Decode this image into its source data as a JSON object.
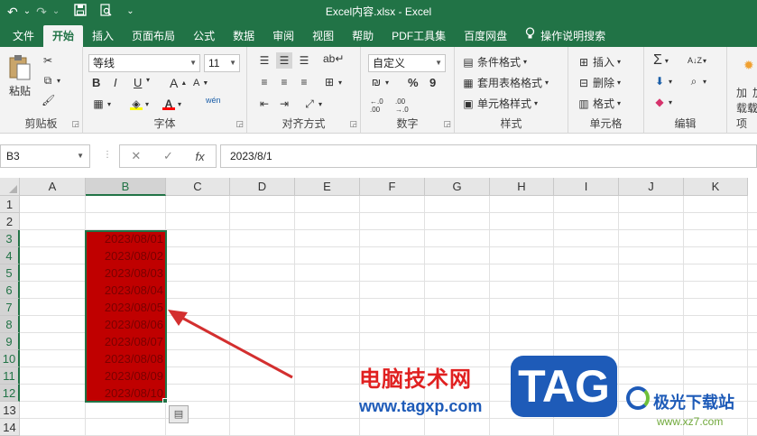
{
  "window": {
    "title": "Excel内容.xlsx  -  Excel"
  },
  "qat": {
    "undo": "↶",
    "undo_dd": "⌄",
    "redo": "↷",
    "redo_dd": "⌄",
    "save": "💾",
    "preview": "🔍",
    "customize": "⌄"
  },
  "tabs": [
    {
      "label": "文件"
    },
    {
      "label": "开始"
    },
    {
      "label": "插入"
    },
    {
      "label": "页面布局"
    },
    {
      "label": "公式"
    },
    {
      "label": "数据"
    },
    {
      "label": "审阅"
    },
    {
      "label": "视图"
    },
    {
      "label": "帮助"
    },
    {
      "label": "PDF工具集"
    },
    {
      "label": "百度网盘"
    },
    {
      "label": "操作说明搜索"
    }
  ],
  "ribbon": {
    "clipboard": {
      "label": "剪贴板",
      "paste": "粘贴"
    },
    "font": {
      "label": "字体",
      "name": "等线",
      "size": "11",
      "bold": "B",
      "italic": "I",
      "underline": "U",
      "grow": "A",
      "shrink": "A",
      "font_color": "A",
      "phonetic": "wén"
    },
    "alignment": {
      "label": "对齐方式"
    },
    "number": {
      "label": "数字",
      "format": "自定义",
      "percent": "%",
      "comma": "9"
    },
    "styles": {
      "label": "样式",
      "conditional": "条件格式",
      "table": "套用表格格式",
      "cell_styles": "单元格样式"
    },
    "cells": {
      "label": "单元格",
      "insert": "插入",
      "delete": "删除",
      "format": "格式"
    },
    "editing": {
      "label": "编辑"
    },
    "addin": {
      "label": "加载项",
      "button": "加",
      "button2": "载项"
    }
  },
  "formula_bar": {
    "name_box": "B3",
    "cancel": "✕",
    "enter": "✓",
    "fx": "fx",
    "value": "2023/8/1"
  },
  "columns": [
    "A",
    "B",
    "C",
    "D",
    "E",
    "F",
    "G",
    "H",
    "I",
    "J",
    "K"
  ],
  "rows": [
    "1",
    "2",
    "3",
    "4",
    "5",
    "6",
    "7",
    "8",
    "9",
    "10",
    "11",
    "12",
    "13",
    "14"
  ],
  "cells": [
    {
      "address": "B3",
      "value": "2023/08/01"
    },
    {
      "address": "B4",
      "value": "2023/08/02"
    },
    {
      "address": "B5",
      "value": "2023/08/03"
    },
    {
      "address": "B6",
      "value": "2023/08/04"
    },
    {
      "address": "B7",
      "value": "2023/08/05"
    },
    {
      "address": "B8",
      "value": "2023/08/06"
    },
    {
      "address": "B9",
      "value": "2023/08/07"
    },
    {
      "address": "B10",
      "value": "2023/08/08"
    },
    {
      "address": "B11",
      "value": "2023/08/09"
    },
    {
      "address": "B12",
      "value": "2023/08/10"
    }
  ],
  "colors": {
    "brand": "#217346",
    "cell_fill": "#c00000",
    "arrow": "#d32f2f"
  },
  "watermark": {
    "title": "电脑技术网",
    "url": "www.tagxp.com",
    "badge": "TAG",
    "site": "极光下载站",
    "site_url": "www.xz7.com"
  }
}
